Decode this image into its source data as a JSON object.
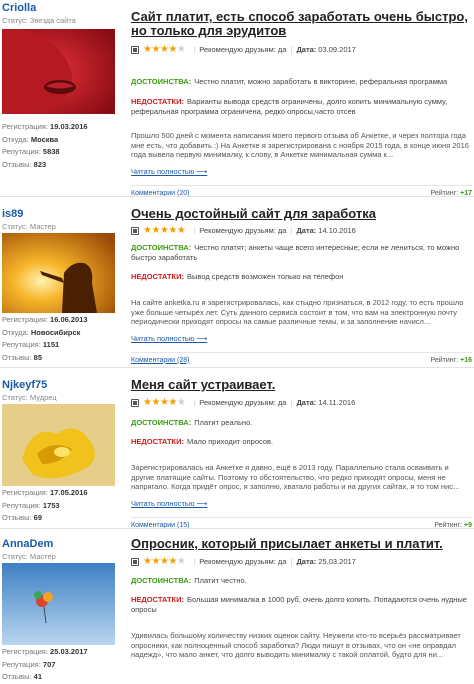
{
  "reviews": [
    {
      "user": {
        "name": "Criolla",
        "status": "Статус: Звезда сайта",
        "stats": [
          {
            "label": "Регистрация:",
            "value": "19.03.2016"
          },
          {
            "label": "Откуда:",
            "value": "Москва"
          },
          {
            "label": "Репутация:",
            "value": "5838"
          },
          {
            "label": "Отзывы:",
            "value": "823"
          }
        ]
      },
      "title": "Сайт платит, есть способ заработать очень быстро, но только для эрудитов",
      "rating": 4,
      "recommend": "Рекомендую друзьям: да",
      "date_label": "Дата:",
      "date": "03.09.2017",
      "pros_label": "ДОСТОИНСТВА:",
      "pros": "Честно платит, можно заработать в викторине, реферальная программа",
      "cons_label": "НЕДОСТАТКИ:",
      "cons": "Варианты вывода средств ограничены, долго копить минимальную сумму, реферальная программа ограничена, редко опросы,часто отсев",
      "body": "Прошло 500 дней с момента написания моего первого отзыва об Анкетке, и через полтора года мне есть, что добавить :) На Анкетке я зарегистрирована с ноября 2015 года, в конце июня 2016 года вывела первую минималку, к слову, в Анкетке минимальная сумма к...",
      "more": "Читать полностью ⟶",
      "comments": "Комментарии (20)",
      "rating_label": "Рейтинг:",
      "score": "+17"
    },
    {
      "user": {
        "name": "is89",
        "status": "Статус: Мастер",
        "stats": [
          {
            "label": "Регистрация:",
            "value": "16.06.2013"
          },
          {
            "label": "Откуда:",
            "value": "Новосибирск"
          },
          {
            "label": "Репутация:",
            "value": "1151"
          },
          {
            "label": "Отзывы:",
            "value": "85"
          }
        ]
      },
      "title": "Очень достойный сайт для заработка",
      "rating": 5,
      "recommend": "Рекомендую друзьям: да",
      "date_label": "Дата:",
      "date": "14.10.2016",
      "pros_label": "ДОСТОИНСТВА:",
      "pros": "Честно платят; анкеты чаще всего интересные; если не лениться, то можно быстро заработать",
      "cons_label": "НЕДОСТАТКИ:",
      "cons": "Вывод средств возможен только на телефон",
      "body": "На сайте anketka.ru я зарегистрировалась, как стыдно признаться, в 2012 году, то есть прошло уже больше четырёх лет. Суть данного сервиса состоит в том, что вам на электронную почту периодически приходят опросы на самые различные темы, и за заполнение начисл...",
      "more": "Читать полностью ⟶",
      "comments": "Комментарии (28)",
      "rating_label": "Рейтинг:",
      "score": "+16"
    },
    {
      "user": {
        "name": "Njkeyf75",
        "status": "Статус: Мудрец",
        "stats": [
          {
            "label": "Регистрация:",
            "value": "17.05.2016"
          },
          {
            "label": "Репутация:",
            "value": "1753"
          },
          {
            "label": "Отзывы:",
            "value": "69"
          }
        ]
      },
      "title": "Меня сайт устраивает.",
      "rating": 4,
      "recommend": "Рекомендую друзьям: да",
      "date_label": "Дата:",
      "date": "14.11.2016",
      "pros_label": "ДОСТОИНСТВА:",
      "pros": "Платит реально.",
      "cons_label": "НЕДОСТАТКИ:",
      "cons": "Мало приходит опросов.",
      "body": "Зарегистрировалась на Анкетке я давно, ещё в 2013 году. Параллельно стала осваивать и другие платящие сайты. Поэтому то обстоятельство, что редко приходят опросы, меня не напрягало. Когда придёт опрос, я заполню, хватало работы и на других сайтах, я то том нис...",
      "more": "Читать полностью ⟶",
      "comments": "Комментарии (15)",
      "rating_label": "Рейтинг:",
      "score": "+9"
    },
    {
      "user": {
        "name": "AnnaDem",
        "status": "Статус: Мастер",
        "stats": [
          {
            "label": "Регистрация:",
            "value": "25.03.2017"
          },
          {
            "label": "Репутация:",
            "value": "707"
          },
          {
            "label": "Отзывы:",
            "value": "41"
          }
        ]
      },
      "title": "Опросник, который присылает анкеты и платит.",
      "rating": 4,
      "recommend": "Рекомендую друзьям: да",
      "date_label": "Дата:",
      "date": "25.03.2017",
      "pros_label": "ДОСТОИНСТВА:",
      "pros": "Платит честно.",
      "cons_label": "НЕДОСТАТКИ:",
      "cons": "Большая минималка в 1000 руб, очень долго копить. Попадаются очень нудные опросы",
      "body": "Удивилась большому количеству низких оценок сайту. Неужели кто-то всерьёз рассматривает опросники, как полноценный способ заработка? Люди пишут в отзывах, что он «не оправдал надежд», что мало анкет, что долго выводить минималку с такой оплатой, будто для ни...",
      "more": "Читать полностью ⟶",
      "comments": "Комментарии",
      "rating_label": "Рейтинг:",
      "score": ""
    }
  ],
  "colors": {
    "link": "#1a5aa6",
    "pros": "#3a9b12",
    "cons": "#d21b1b",
    "star": "#f2a100"
  }
}
